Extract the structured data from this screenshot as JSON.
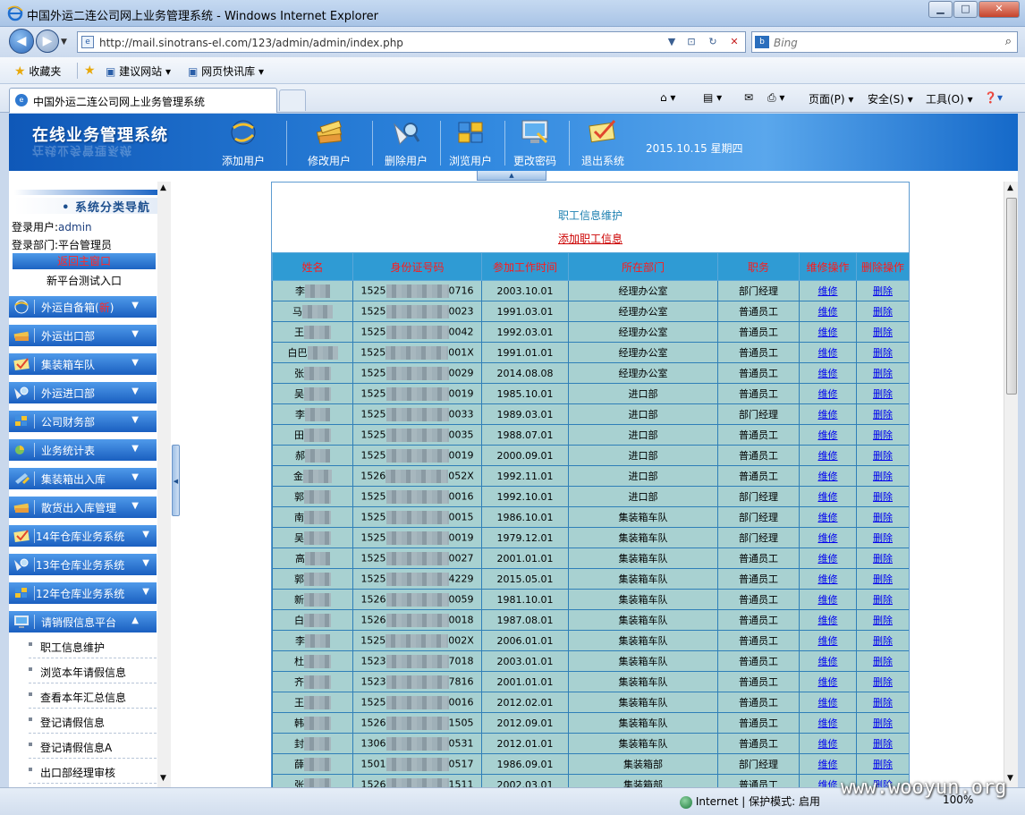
{
  "window": {
    "title": "中国外运二连公司网上业务管理系统 - Windows Internet Explorer",
    "url": "http://mail.sinotrans-el.com/123/admin/admin/index.php",
    "search_placeholder": "Bing",
    "favorites_label": "收藏夹",
    "fav_links": [
      "建议网站 ▾",
      "网页快讯库 ▾"
    ],
    "tab_title": "中国外运二连公司网上业务管理系统",
    "commands": [
      "页面(P) ▾",
      "安全(S) ▾",
      "工具(O) ▾"
    ],
    "status_zone": "Internet | 保护模式: 启用",
    "zoom": "100%",
    "watermark": "www.wooyun.org"
  },
  "banner": {
    "logo": "在线业务管理系统",
    "buttons": [
      {
        "label": "添加用户",
        "icon": "add-user-icon"
      },
      {
        "label": "修改用户",
        "icon": "edit-user-icon"
      },
      {
        "label": "删除用户",
        "icon": "delete-user-icon"
      },
      {
        "label": "浏览用户",
        "icon": "browse-users-icon"
      },
      {
        "label": "更改密码",
        "icon": "change-password-icon"
      },
      {
        "label": "退出系统",
        "icon": "logout-icon"
      }
    ],
    "date": "2015.10.15 星期四"
  },
  "sidebar": {
    "heading": "系统分类导航",
    "login_user_label": "登录用户:",
    "login_user": "admin",
    "login_dept_label": "登录部门:",
    "login_dept": "平台管理员",
    "home_button": "返回主窗口",
    "new_platform": "新平台测试入口",
    "categories": [
      {
        "label": "外运自备箱(",
        "new": "新",
        "tail": ")"
      },
      {
        "label": "外运出口部"
      },
      {
        "label": "集装箱车队"
      },
      {
        "label": "外运进口部"
      },
      {
        "label": "公司财务部"
      },
      {
        "label": "业务统计表"
      },
      {
        "label": "集装箱出入库"
      },
      {
        "label": "散货出入库管理"
      },
      {
        "label": "14年仓库业务系统"
      },
      {
        "label": "13年仓库业务系统"
      },
      {
        "label": "12年仓库业务系统"
      },
      {
        "label": "请销假信息平台"
      }
    ],
    "subitems": [
      "职工信息维护",
      "浏览本年请假信息",
      "查看本年汇总信息",
      "登记请假信息",
      "登记请假信息A",
      "出口部经理审核"
    ]
  },
  "main": {
    "title": "职工信息维护",
    "add_link": "添加职工信息",
    "columns": [
      "姓名",
      "身份证号码",
      "参加工作时间",
      "所在部门",
      "职务",
      "维修操作",
      "删除操作"
    ],
    "edit_label": "维修",
    "delete_label": "删除",
    "rows": [
      {
        "name": "李",
        "id_pre": "1525",
        "id_suf": "0716",
        "date": "2003.10.01",
        "dept": "经理办公室",
        "title": "部门经理"
      },
      {
        "name": "马",
        "id_pre": "1525",
        "id_suf": "0023",
        "date": "1991.03.01",
        "dept": "经理办公室",
        "title": "普通员工"
      },
      {
        "name": "王",
        "id_pre": "1525",
        "id_suf": "0042",
        "date": "1992.03.01",
        "dept": "经理办公室",
        "title": "普通员工"
      },
      {
        "name": "白巴",
        "id_pre": "1525",
        "id_suf": "001X",
        "date": "1991.01.01",
        "dept": "经理办公室",
        "title": "普通员工"
      },
      {
        "name": "张",
        "id_pre": "1525",
        "id_suf": "0029",
        "date": "2014.08.08",
        "dept": "经理办公室",
        "title": "普通员工"
      },
      {
        "name": "吴",
        "id_pre": "1525",
        "id_suf": "0019",
        "date": "1985.10.01",
        "dept": "进口部",
        "title": "普通员工"
      },
      {
        "name": "李",
        "id_pre": "1525",
        "id_suf": "0033",
        "date": "1989.03.01",
        "dept": "进口部",
        "title": "部门经理"
      },
      {
        "name": "田",
        "id_pre": "1525",
        "id_suf": "0035",
        "date": "1988.07.01",
        "dept": "进口部",
        "title": "普通员工"
      },
      {
        "name": "郝",
        "id_pre": "1525",
        "id_suf": "0019",
        "date": "2000.09.01",
        "dept": "进口部",
        "title": "普通员工"
      },
      {
        "name": "金",
        "id_pre": "1526",
        "id_suf": "052X",
        "date": "1992.11.01",
        "dept": "进口部",
        "title": "普通员工"
      },
      {
        "name": "郭",
        "id_pre": "1525",
        "id_suf": "0016",
        "date": "1992.10.01",
        "dept": "进口部",
        "title": "部门经理"
      },
      {
        "name": "南",
        "id_pre": "1525",
        "id_suf": "0015",
        "date": "1986.10.01",
        "dept": "集装箱车队",
        "title": "部门经理"
      },
      {
        "name": "吴",
        "id_pre": "1525",
        "id_suf": "0019",
        "date": "1979.12.01",
        "dept": "集装箱车队",
        "title": "部门经理"
      },
      {
        "name": "高",
        "id_pre": "1525",
        "id_suf": "0027",
        "date": "2001.01.01",
        "dept": "集装箱车队",
        "title": "普通员工"
      },
      {
        "name": "郭",
        "id_pre": "1525",
        "id_suf": "4229",
        "date": "2015.05.01",
        "dept": "集装箱车队",
        "title": "普通员工"
      },
      {
        "name": "新",
        "id_pre": "1526",
        "id_suf": "0059",
        "date": "1981.10.01",
        "dept": "集装箱车队",
        "title": "普通员工"
      },
      {
        "name": "白",
        "id_pre": "1526",
        "id_suf": "0018",
        "date": "1987.08.01",
        "dept": "集装箱车队",
        "title": "普通员工"
      },
      {
        "name": "李",
        "id_pre": "1525",
        "id_suf": "002X",
        "date": "2006.01.01",
        "dept": "集装箱车队",
        "title": "普通员工"
      },
      {
        "name": "杜",
        "id_pre": "1523",
        "id_suf": "7018",
        "date": "2003.01.01",
        "dept": "集装箱车队",
        "title": "普通员工"
      },
      {
        "name": "齐",
        "id_pre": "1523",
        "id_suf": "7816",
        "date": "2001.01.01",
        "dept": "集装箱车队",
        "title": "普通员工"
      },
      {
        "name": "王",
        "id_pre": "1525",
        "id_suf": "0016",
        "date": "2012.02.01",
        "dept": "集装箱车队",
        "title": "普通员工"
      },
      {
        "name": "韩",
        "id_pre": "1526",
        "id_suf": "1505",
        "date": "2012.09.01",
        "dept": "集装箱车队",
        "title": "普通员工"
      },
      {
        "name": "封",
        "id_pre": "1306",
        "id_suf": "0531",
        "date": "2012.01.01",
        "dept": "集装箱车队",
        "title": "普通员工"
      },
      {
        "name": "薛",
        "id_pre": "1501",
        "id_suf": "0517",
        "date": "1986.09.01",
        "dept": "集装箱部",
        "title": "部门经理"
      },
      {
        "name": "张",
        "id_pre": "1526",
        "id_suf": "1511",
        "date": "2002.03.01",
        "dept": "集装箱部",
        "title": "普通员工"
      }
    ]
  },
  "colors": {
    "banner": "#1f74d2",
    "header_row": "#2f9bd4",
    "row_bg": "#a8d1d1",
    "header_text": "#ff1a1a",
    "link": "#0000ee"
  }
}
